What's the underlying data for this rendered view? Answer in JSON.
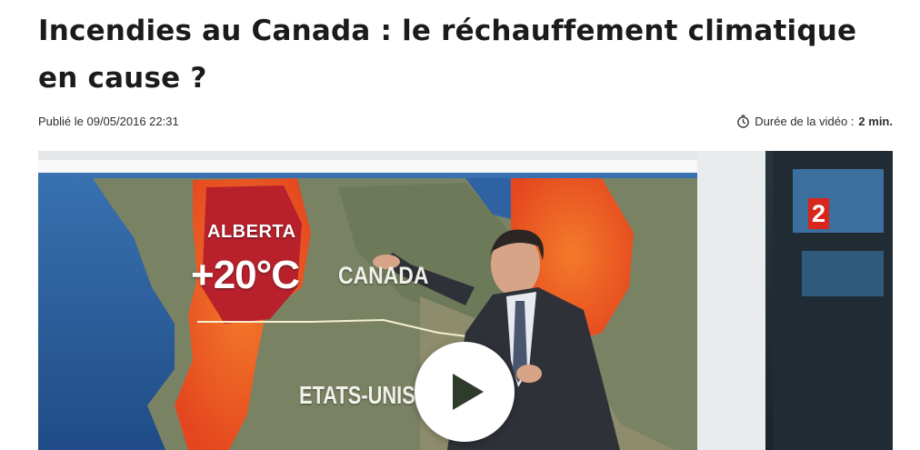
{
  "article": {
    "title": "Incendies au Canada : le réchauffement climatique en cause ?",
    "published": "Publié le 09/05/2016 22:31",
    "duration_label": "Durée de la vidéo :",
    "duration_value": "2 min."
  },
  "video": {
    "map_labels": {
      "region": "ALBERTA",
      "temperature": "+20°C",
      "country": "CANADA",
      "neighbor": "ETATS-UNIS"
    },
    "channel_logo": "2",
    "play_icon": "play-icon"
  },
  "icons": {
    "clock": "clock-icon"
  },
  "colors": {
    "heat_orange": "#ef5a24",
    "heat_dark": "#b8212c",
    "ocean": "#2b5d9a",
    "land": "#7c8465",
    "logo_red": "#d9261c",
    "play_icon": "#2f3b2b"
  }
}
